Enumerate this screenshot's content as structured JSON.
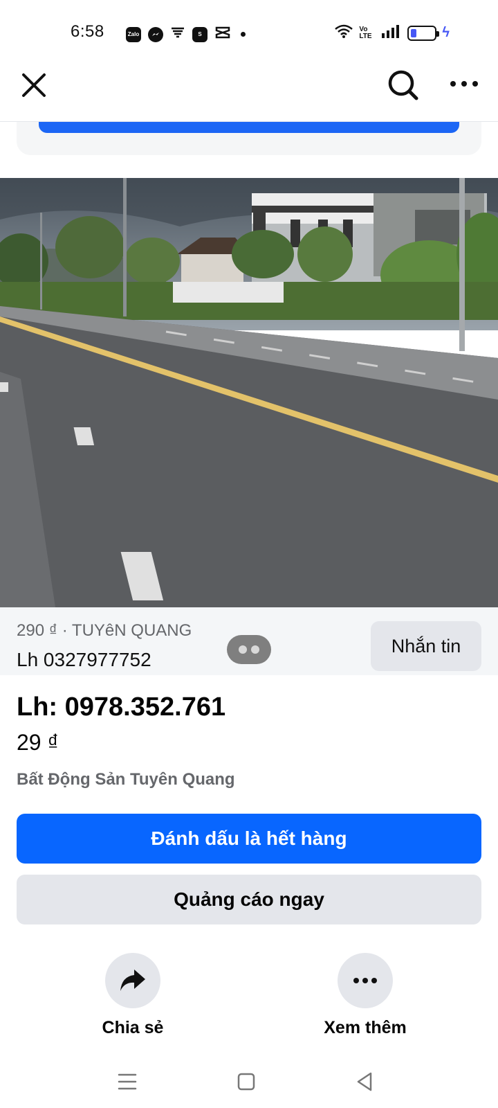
{
  "status_bar": {
    "time": "6:58",
    "icons": [
      "zalo-icon",
      "messenger-icon",
      "wifi-calling-icon",
      "shopee-icon",
      "capcut-icon"
    ],
    "volte": "Vo LTE",
    "battery_color": "#4657f5"
  },
  "listing": {
    "strip_price_location": "290 ₫ · TUYêN QUANG",
    "strip_phone": "Lh 0327977752",
    "message_label": "Nhắn tin",
    "title": "Lh: 0978.352.761",
    "price": "29 ₫",
    "group": "Bất Động Sản Tuyên Quang"
  },
  "buttons": {
    "mark_sold": "Đánh dấu là hết hàng",
    "advertise": "Quảng cáo ngay"
  },
  "actions": {
    "share": "Chia sẻ",
    "more": "Xem thêm"
  },
  "colors": {
    "primary": "#0866ff",
    "secondary_bg": "#e4e6eb",
    "muted_text": "#65676b"
  }
}
